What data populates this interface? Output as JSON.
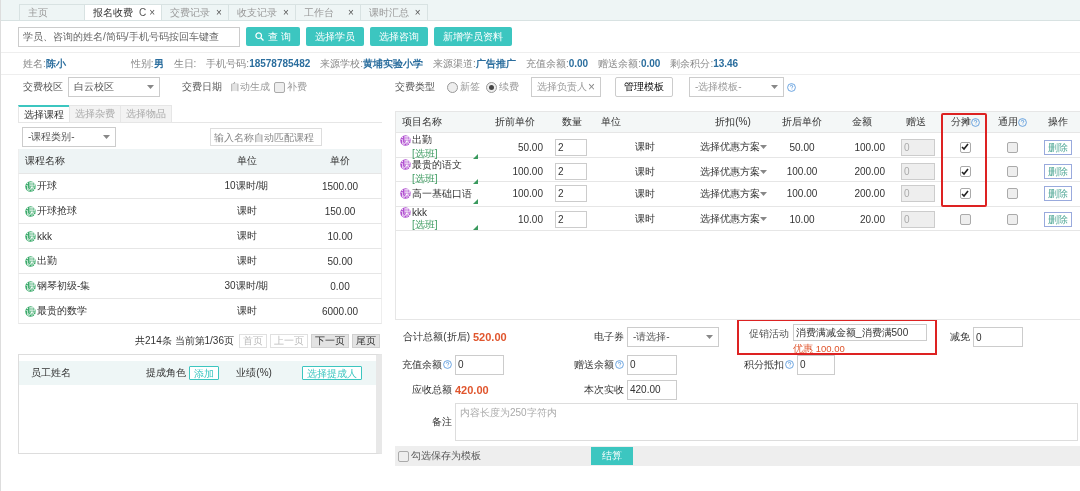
{
  "tabs": [
    {
      "label": "主页",
      "selected": false
    },
    {
      "label": "报名收费",
      "selected": true,
      "refresh": "C",
      "close": "×"
    },
    {
      "label": "交费记录",
      "selected": false,
      "close": "×"
    },
    {
      "label": "收支记录",
      "selected": false,
      "close": "×"
    },
    {
      "label": "工作台",
      "selected": false,
      "close": "×"
    },
    {
      "label": "课时汇总",
      "selected": false,
      "close": "×"
    }
  ],
  "search": {
    "placeholder": "学员、咨询的姓名/简码/手机号码按回车键查",
    "buttons": [
      {
        "label": "查 询",
        "kind": "search"
      },
      {
        "label": "选择学员",
        "kind": "plain"
      },
      {
        "label": "选择咨询",
        "kind": "plain"
      },
      {
        "label": "新增学员资料",
        "kind": "plain"
      }
    ]
  },
  "student": [
    {
      "label": "姓名:",
      "value": "陈小"
    },
    {
      "label": "性别:",
      "value": "男"
    },
    {
      "label": "生日:"
    },
    {
      "label": "手机号码:",
      "value": "18578785482"
    },
    {
      "label": "来源学校:",
      "value": "黄埔实验小学"
    },
    {
      "label": "来源渠道:",
      "value": "广告推广"
    },
    {
      "label": "充值余额:",
      "value": "0.00"
    },
    {
      "label": "赠送余额:",
      "value": "0.00"
    },
    {
      "label": "剩余积分:",
      "value": "13.46"
    }
  ],
  "options": {
    "campus": {
      "label": "交费校区",
      "value": "白云校区"
    },
    "date": {
      "label": "交费日期",
      "value": "自动生成"
    },
    "supplement": {
      "label": "补费",
      "checked": false
    },
    "type": {
      "label": "交费类型",
      "options": [
        {
          "label": "新签",
          "selected": false
        },
        {
          "label": "续费",
          "selected": true
        }
      ]
    },
    "manager": {
      "placeholder": "选择负责人",
      "clear": "×"
    },
    "template_button": "管理模板",
    "template_select": {
      "placeholder": "-选择模板-"
    }
  },
  "left": {
    "tabs": [
      {
        "label": "选择课程",
        "selected": true
      },
      {
        "label": "选择杂费",
        "selected": false
      },
      {
        "label": "选择物品",
        "selected": false
      }
    ],
    "category": {
      "value": "-课程类别-"
    },
    "filter": {
      "placeholder": "输入名称自动匹配课程"
    },
    "columns": [
      "课程名称",
      "单位",
      "单价"
    ],
    "rows": [
      {
        "badge": "课",
        "name": "开球",
        "unit": "10课时/期",
        "price": "1500.00"
      },
      {
        "badge": "课",
        "name": "开球抢球",
        "unit": "课时",
        "price": "150.00"
      },
      {
        "badge": "课",
        "name": "kkk",
        "unit": "课时",
        "price": "10.00"
      },
      {
        "badge": "课",
        "name": "出勤",
        "unit": "课时",
        "price": "50.00"
      },
      {
        "badge": "课",
        "name": "钢琴初级-集",
        "unit": "30课时/期",
        "price": "0.00"
      },
      {
        "badge": "课",
        "name": "最贵的数学",
        "unit": "课时",
        "price": "6000.00"
      }
    ],
    "pagination": {
      "summary": "共214条 当前第1/36页",
      "buttons": [
        {
          "label": "首页",
          "disabled": true
        },
        {
          "label": "上一页",
          "disabled": true
        },
        {
          "label": "下一页",
          "disabled": false
        },
        {
          "label": "尾页",
          "disabled": false
        }
      ]
    }
  },
  "staff": {
    "columns": [
      {
        "label": "员工姓名"
      },
      {
        "label": "提成角色",
        "action": "添加"
      },
      {
        "label": "业绩(%)"
      },
      {
        "action": "选择提成人"
      }
    ]
  },
  "items": {
    "columns": [
      {
        "label": "项目名称"
      },
      {
        "label": "折前单价"
      },
      {
        "label": "数量"
      },
      {
        "label": "单位"
      },
      {
        "label": "折扣(%)"
      },
      {
        "label": "折后单价"
      },
      {
        "label": "金额"
      },
      {
        "label": "赠送"
      },
      {
        "label": "分摊",
        "help": true,
        "highlighted": true
      },
      {
        "label": "通用",
        "help": true
      },
      {
        "label": "操作"
      }
    ],
    "rows": [
      {
        "badge": "课",
        "name": "出勤",
        "class_link": "[选班]",
        "price": "50.00",
        "qty": "2",
        "unit": "课时",
        "discount": "选择优惠方案",
        "after": "50.00",
        "amount": "100.00",
        "gift": "0",
        "share": true,
        "general": false,
        "action": "删除"
      },
      {
        "badge": "课",
        "name": "最贵的语文",
        "class_link": "[选班]",
        "price": "100.00",
        "qty": "2",
        "unit": "课时",
        "discount": "选择优惠方案",
        "after": "100.00",
        "amount": "200.00",
        "gift": "0",
        "share": true,
        "general": false,
        "action": "删除"
      },
      {
        "badge": "课",
        "name": "高一基础口语",
        "price": "100.00",
        "qty": "2",
        "unit": "课时",
        "discount": "选择优惠方案",
        "after": "100.00",
        "amount": "200.00",
        "gift": "0",
        "share": true,
        "general": false,
        "action": "删除"
      },
      {
        "badge": "课",
        "name": "kkk",
        "class_link": "[选班]",
        "price": "10.00",
        "qty": "2",
        "unit": "课时",
        "discount": "选择优惠方案",
        "after": "10.00",
        "amount": "20.00",
        "gift": "0",
        "share": false,
        "general": false,
        "action": "删除"
      }
    ]
  },
  "summary": {
    "total": {
      "label": "合计总额(折后)",
      "value": "520.00"
    },
    "coupon": {
      "label": "电子券",
      "value": "-请选择-"
    },
    "promo": {
      "label": "促销活动",
      "value": "消费满减金额_消费满500",
      "note": "优惠 100.00",
      "highlighted": true
    },
    "waive": {
      "label": "减免",
      "value": "0"
    },
    "recharge": {
      "label": "充值余额",
      "value": "0"
    },
    "gift_balance": {
      "label": "赠送余额",
      "value": "0"
    },
    "points": {
      "label": "积分抵扣",
      "value": "0"
    },
    "receivable": {
      "label": "应收总额",
      "value": "420.00"
    },
    "paid": {
      "label": "本次实收",
      "value": "420.00"
    },
    "remark": {
      "label": "备注",
      "placeholder": "内容长度为250字符内"
    },
    "save_template": {
      "label": "勾选保存为模板",
      "checked": false
    },
    "submit": "结算"
  }
}
